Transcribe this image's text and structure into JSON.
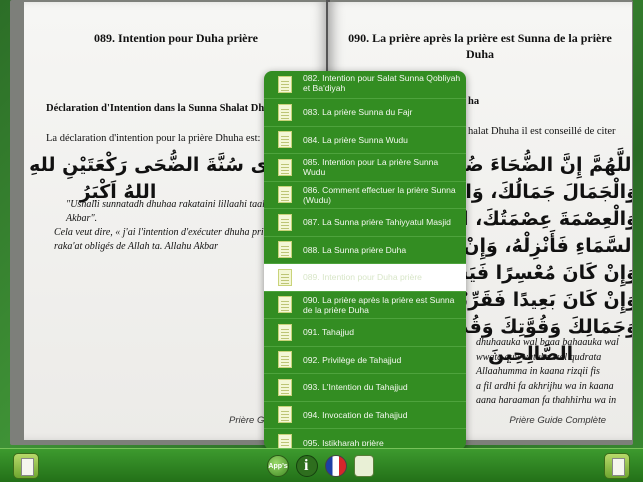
{
  "left_page": {
    "title": "089. Intention pour Duha prière",
    "subheading": "Déclaration d'Intention dans la Sunna Shalat Dhuha",
    "intro": "La déclaration d'intention pour la prière Dhuha est:",
    "arabic_line1": "ى سُنَّةَ الضُّحَى رَكْعَتَيْنِ للهِ تَعَالَى،",
    "arabic_line2": "اللهُ اَكْبَرُ",
    "transliteration": "\"Ushalli sunnatadh dhuhaa rakataini lillaahi taalaa. Allahu Akbar\".",
    "meaning": "Cela veut dire, « j'ai l'intention d'exécuter dhuha prière cycles raka'at obligés de Allah ta. Allahu Akbar",
    "footer": "Prière Guide"
  },
  "right_page": {
    "title": "090. La prière après la prière est Sunna de la prière Duha",
    "partial_heading": "ha",
    "partial_intro": "halat Dhuha il est conseillé de citer",
    "arabic_lines": [
      "اللَّهُمَّ إِنَّ الضُّحَاءَ ضُحَ",
      "وَالْجَمَالَ جَمَالُكَ، وَالْقُوَّةَ",
      "وَالْعِصْمَةَ عِصْمَتُكَ، اللَّ",
      "السَّمَاءِ فَأَنْزِلْهُ، وَإِنْ كَانَ",
      "وَإِنْ كَانَ مُعْسِرًا فَيَسِّرْهُ، وَ",
      "وَإِنْ كَانَ بَعِيدًا فَقَرِّبْهُ بِحَقِّ",
      "وَجَمَالِكَ وَقُوَّتِكَ وَقُدْرَتِكَ",
      "الصَّالِحِينَ"
    ],
    "transliteration_lines": [
      "dhuhaauka wal baaa bahaauka wal",
      "wwata quwwatuka wal qudrata",
      "Allaahumma in kaana rizqii fis",
      "a fil ardhi fa akhrijhu wa in kaana",
      "aana haraaman fa thahhirhu wa in"
    ],
    "footer": "Prière Guide Complète"
  },
  "menu": {
    "items": [
      {
        "label": "082. Intention pour Salat Sunna Qobliyah et Ba'diyah",
        "selected": false
      },
      {
        "label": "083. La prière Sunna du Fajr",
        "selected": false
      },
      {
        "label": "084. La prière Sunna Wudu",
        "selected": false
      },
      {
        "label": "085. Intention pour La prière Sunna Wudu",
        "selected": false
      },
      {
        "label": "086. Comment effectuer la prière Sunna (Wudu)",
        "selected": false
      },
      {
        "label": "087. La Sunna prière Tahiyyatul Masjid",
        "selected": false
      },
      {
        "label": "088. La Sunna prière Duha",
        "selected": false
      },
      {
        "label": "089. Intention pour Duha prière",
        "selected": true
      },
      {
        "label": "090. La prière après la prière est Sunna de la prière Duha",
        "selected": false
      },
      {
        "label": "091. Tahajjud",
        "selected": false
      },
      {
        "label": "092. Privilège de Tahajjud",
        "selected": false
      },
      {
        "label": "093. L'Intention du Tahajjud",
        "selected": false
      },
      {
        "label": "094. Invocation de Tahajjud",
        "selected": false
      },
      {
        "label": "095. Istikharah prière",
        "selected": false
      }
    ]
  },
  "toolbar": {
    "app_label": "App’s",
    "buttons": [
      "left-page-icon",
      "apps-icon",
      "info-icon",
      "french-flag-icon",
      "page-list-icon",
      "right-page-icon"
    ]
  }
}
